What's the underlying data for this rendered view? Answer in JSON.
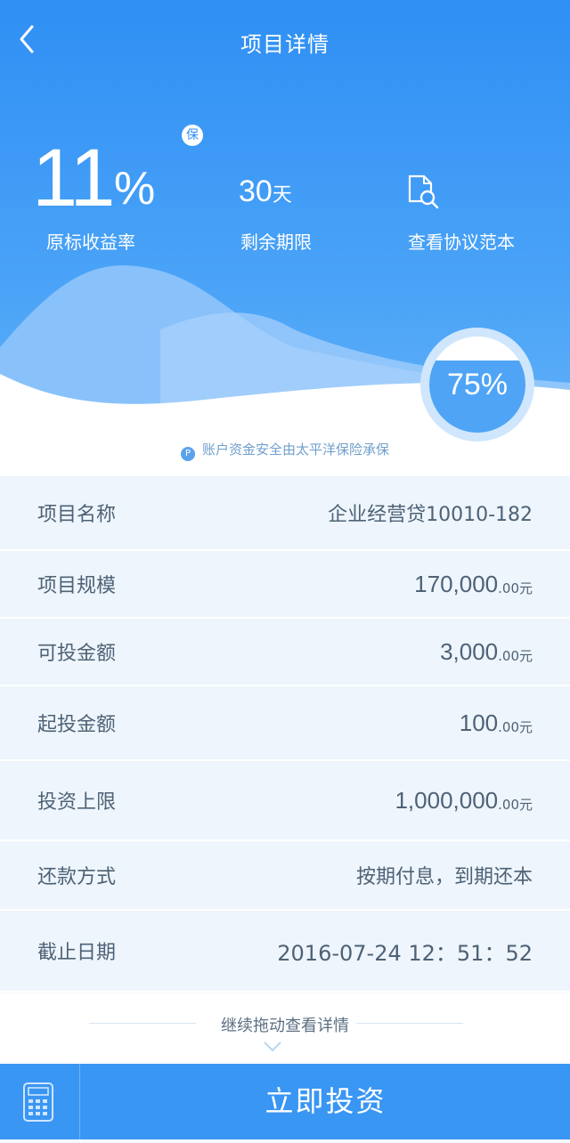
{
  "nav": {
    "title": "项目详情"
  },
  "hero": {
    "rate_value": "11",
    "rate_percent": "%",
    "bao_badge": "保",
    "rate_label": "原标收益率",
    "days_value": "30",
    "days_unit": "天",
    "days_label": "剩余期限",
    "agreement_label": "查看协议范本",
    "progress_text": "75%",
    "progress_fraction": 0.75,
    "insurance_text": "账户资金安全由太平洋保险承保",
    "insurance_icon": "P"
  },
  "details": [
    {
      "label": "项目名称",
      "value": "企业经营贷10010-182",
      "unit": ""
    },
    {
      "label": "项目规模",
      "value": "170,000",
      "unit": ".00元"
    },
    {
      "label": "可投金额",
      "value": "3,000",
      "unit": ".00元"
    },
    {
      "label": "起投金额",
      "value": "100",
      "unit": ".00元"
    },
    {
      "label": "投资上限",
      "value": "1,000,000",
      "unit": ".00元"
    },
    {
      "label": "还款方式",
      "value": "按期付息，到期还本",
      "unit": ""
    },
    {
      "label": "截止日期",
      "value": "2016-07-24 12：51：52",
      "unit": ""
    }
  ],
  "more": {
    "text": "继续拖动查看详情"
  },
  "footer": {
    "invest_label": "立即投资"
  },
  "colors": {
    "primary": "#3996f3",
    "accent_light": "#cfe6fd",
    "text": "#4e6276"
  }
}
